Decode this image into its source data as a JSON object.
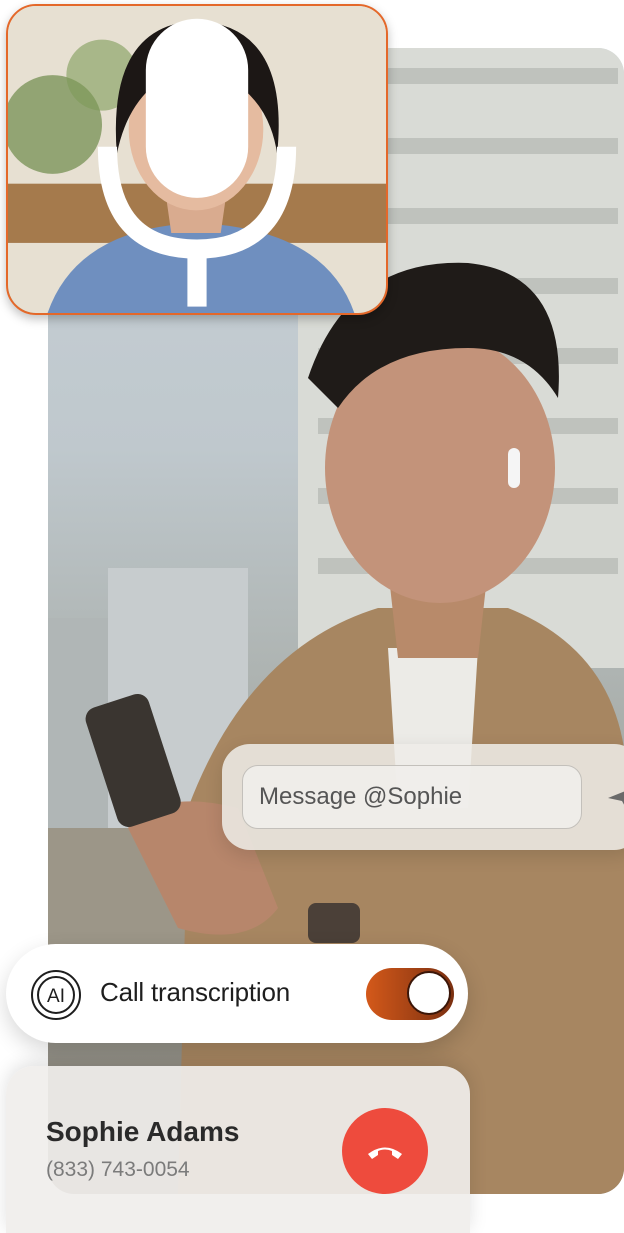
{
  "message": {
    "placeholder": "Message @Sophie"
  },
  "transcription": {
    "ai_badge": "AI",
    "label": "Call transcription",
    "enabled": true
  },
  "contact": {
    "name": "Sophie Adams",
    "phone": "(833) 743-0054"
  },
  "colors": {
    "accent": "#e4682a",
    "hangup": "#ee4b3d",
    "toggle_start": "#d4591a",
    "toggle_end": "#7a2f10"
  },
  "icons": {
    "mic": "microphone-icon",
    "send": "send-icon",
    "ai": "ai-icon",
    "hangup": "phone-hangup-icon"
  }
}
